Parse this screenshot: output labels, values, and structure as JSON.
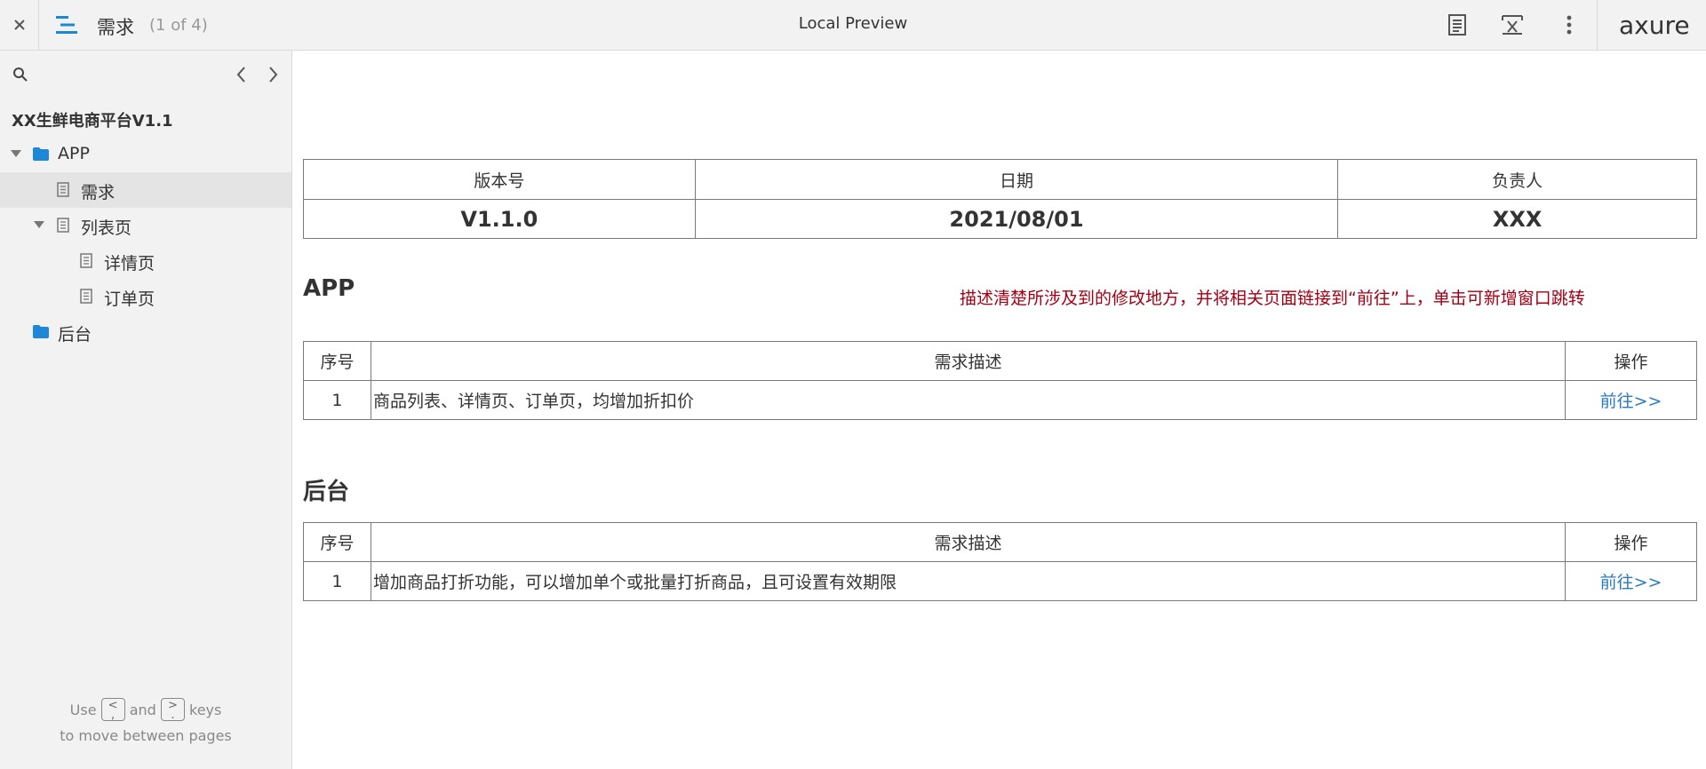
{
  "topbar": {
    "page_name": "需求",
    "page_count": "(1 of 4)",
    "title": "Local Preview",
    "logo": "axure",
    "icons": [
      "close-icon",
      "sitemap-menu-icon",
      "notes-icon",
      "variables-icon",
      "more-icon"
    ]
  },
  "sidebar": {
    "project_name": "XX生鲜电商平台V1.1",
    "tree": [
      {
        "label": "APP",
        "type": "folder",
        "expanded": true
      },
      {
        "label": "需求",
        "type": "page",
        "selected": true
      },
      {
        "label": "列表页",
        "type": "page",
        "expanded": true
      },
      {
        "label": "详情页",
        "type": "page"
      },
      {
        "label": "订单页",
        "type": "page"
      },
      {
        "label": "后台",
        "type": "folder"
      }
    ],
    "hint_use": "Use",
    "hint_key_prev": "<\n,",
    "hint_and": "and",
    "hint_key_next": ">\n.",
    "hint_keys": "keys",
    "hint_line2": "to move between pages"
  },
  "version_table": {
    "headers": [
      "版本号",
      "日期",
      "负责人"
    ],
    "values": [
      "V1.1.0",
      "2021/08/01",
      "XXX"
    ]
  },
  "app_section": {
    "title": "APP",
    "note": "描述清楚所涉及到的修改地方，并将相关页面链接到“前往”上，单击可新增窗口跳转",
    "headers": [
      "序号",
      "需求描述",
      "操作"
    ],
    "rows": [
      {
        "no": "1",
        "desc": "商品列表、详情页、订单页，均增加折扣价",
        "action": "前往>>"
      }
    ]
  },
  "admin_section": {
    "title": "后台",
    "headers": [
      "序号",
      "需求描述",
      "操作"
    ],
    "rows": [
      {
        "no": "1",
        "desc": "增加商品打折功能，可以增加单个或批量打折商品，且可设置有效期限",
        "action": "前往>>"
      }
    ]
  },
  "colors": {
    "accent": "#2a7ac0",
    "note_red": "#a30014",
    "folder_blue": "#1e88d6",
    "chrome_bg": "#f2f2f2"
  }
}
